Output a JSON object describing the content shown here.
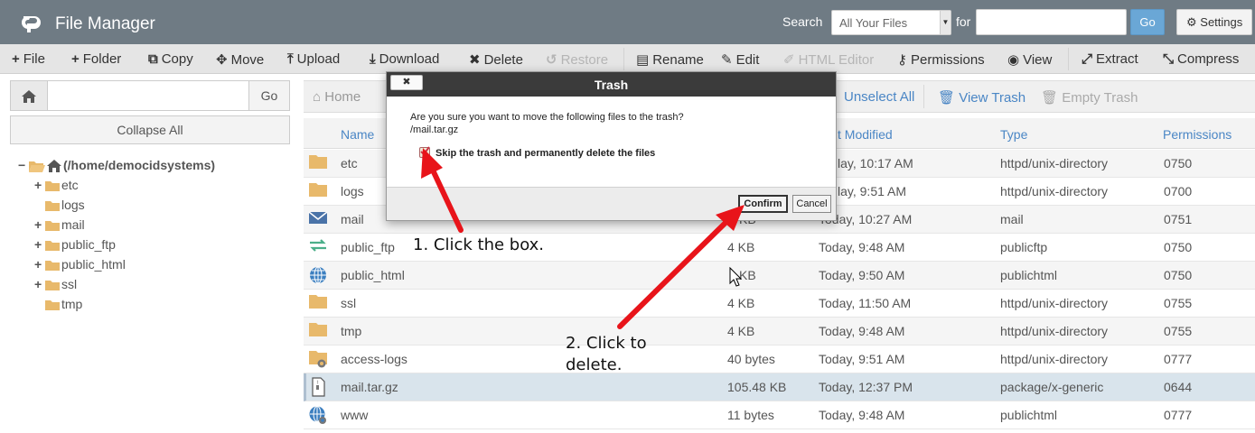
{
  "header": {
    "title": "File Manager",
    "search_label": "Search",
    "search_scope": "All Your Files",
    "for_label": "for",
    "search_value": "",
    "go_label": "Go",
    "settings_label": "Settings"
  },
  "toolbar": {
    "file": "File",
    "folder": "Folder",
    "copy": "Copy",
    "move": "Move",
    "upload": "Upload",
    "download": "Download",
    "delete": "Delete",
    "restore": "Restore",
    "rename": "Rename",
    "edit": "Edit",
    "html_editor": "HTML Editor",
    "permissions": "Permissions",
    "view": "View",
    "extract": "Extract",
    "compress": "Compress"
  },
  "left": {
    "path_value": "",
    "go_label": "Go",
    "collapse_label": "Collapse All",
    "tree_root": "(/home/democidsystems)",
    "tree": [
      {
        "label": "etc",
        "expander": "+"
      },
      {
        "label": "logs",
        "expander": ""
      },
      {
        "label": "mail",
        "expander": "+"
      },
      {
        "label": "public_ftp",
        "expander": "+"
      },
      {
        "label": "public_html",
        "expander": "+"
      },
      {
        "label": "ssl",
        "expander": "+"
      },
      {
        "label": "tmp",
        "expander": ""
      }
    ]
  },
  "nav": {
    "home": "Home",
    "unselect_all": "Unselect All",
    "view_trash": "View Trash",
    "empty_trash": "Empty Trash"
  },
  "table": {
    "headers": {
      "name": "Name",
      "modified": "t Modified",
      "type": "Type",
      "permissions": "Permissions"
    },
    "rows": [
      {
        "name": "etc",
        "size": "",
        "modified": "lay, 10:17 AM",
        "type": "httpd/unix-directory",
        "perm": "0750",
        "icon": "folder-icon"
      },
      {
        "name": "logs",
        "size": "",
        "modified": "lay, 9:51 AM",
        "type": "httpd/unix-directory",
        "perm": "0700",
        "icon": "folder-icon"
      },
      {
        "name": "mail",
        "size": "KB",
        "modified": "Today, 10:27 AM",
        "type": "mail",
        "perm": "0751",
        "icon": "mail-icon"
      },
      {
        "name": "public_ftp",
        "size": "4 KB",
        "modified": "Today, 9:48 AM",
        "type": "publicftp",
        "perm": "0750",
        "icon": "transfer-icon"
      },
      {
        "name": "public_html",
        "size": "KB",
        "modified": "Today, 9:50 AM",
        "type": "publichtml",
        "perm": "0750",
        "icon": "globe-icon"
      },
      {
        "name": "ssl",
        "size": "4 KB",
        "modified": "Today, 11:50 AM",
        "type": "httpd/unix-directory",
        "perm": "0755",
        "icon": "folder-icon"
      },
      {
        "name": "tmp",
        "size": "4 KB",
        "modified": "Today, 9:48 AM",
        "type": "httpd/unix-directory",
        "perm": "0755",
        "icon": "folder-icon"
      },
      {
        "name": "access-logs",
        "size": "40 bytes",
        "modified": "Today, 9:51 AM",
        "type": "httpd/unix-directory",
        "perm": "0777",
        "icon": "folder-link-icon"
      },
      {
        "name": "mail.tar.gz",
        "size": "105.48 KB",
        "modified": "Today, 12:37 PM",
        "type": "package/x-generic",
        "perm": "0644",
        "icon": "archive-icon"
      },
      {
        "name": "www",
        "size": "11 bytes",
        "modified": "Today, 9:48 AM",
        "type": "publichtml",
        "perm": "0777",
        "icon": "globe-link-icon"
      }
    ]
  },
  "modal": {
    "title": "Trash",
    "close_label": "✖",
    "message": "Are you sure you want to move the following files to the trash?",
    "file": "/mail.tar.gz",
    "checkbox_label": "Skip the trash and permanently delete the files",
    "checked": true,
    "confirm_label": "Confirm",
    "cancel_label": "Cancel"
  },
  "annotations": {
    "step1": "1. Click the box.",
    "step2": "2. Click to\ndelete."
  },
  "colors": {
    "header_bg": "#6f7b84",
    "link_blue": "#4a86c5",
    "folder": "#e8b96b",
    "arrow_red": "#e8141a"
  }
}
